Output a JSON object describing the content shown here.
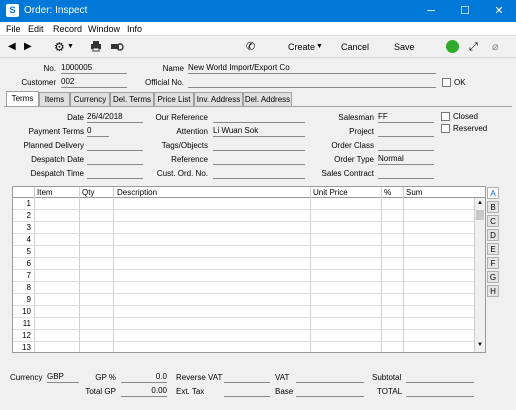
{
  "window": {
    "title": "Order: Inspect",
    "minimize": "─",
    "maximize": "☐",
    "close": "✕"
  },
  "menu": [
    "File",
    "Edit",
    "Record",
    "Window",
    "Info"
  ],
  "toolbar": {
    "create": "Create",
    "cancel": "Cancel",
    "save": "Save"
  },
  "head": {
    "no_label": "No.",
    "no_value": "1000005",
    "name_label": "Name",
    "name_value": "New World Import/Export Co",
    "customer_label": "Customer",
    "customer_value": "002",
    "official_label": "Official No.",
    "official_value": "",
    "ok_label": "OK"
  },
  "tabs": [
    "Terms",
    "Items",
    "Currency",
    "Del. Terms",
    "Price List",
    "Inv. Address",
    "Del. Address"
  ],
  "terms": {
    "date_label": "Date",
    "date_value": "26/4/2018",
    "payment_label": "Payment Terms",
    "payment_value": "0",
    "planned_label": "Planned Delivery",
    "planned_value": "",
    "despdate_label": "Despatch Date",
    "despdate_value": "",
    "desptime_label": "Despatch Time",
    "desptime_value": "",
    "ourref_label": "Our Reference",
    "ourref_value": "",
    "attention_label": "Attention",
    "attention_value": "Li Wuan Sok",
    "tags_label": "Tags/Objects",
    "tags_value": "",
    "reference_label": "Reference",
    "reference_value": "",
    "custord_label": "Cust. Ord. No.",
    "custord_value": "",
    "salesman_label": "Salesman",
    "salesman_value": "FF",
    "project_label": "Project",
    "project_value": "",
    "orderclass_label": "Order Class",
    "orderclass_value": "",
    "ordertype_label": "Order Type",
    "ordertype_value": "Normal",
    "salescontract_label": "Sales Contract",
    "salescontract_value": "",
    "closed_label": "Closed",
    "reserved_label": "Reserved"
  },
  "grid": {
    "headers": [
      "Item",
      "Qty",
      "Description",
      "Unit Price",
      "%",
      "Sum"
    ],
    "rows": [
      "1",
      "2",
      "3",
      "4",
      "5",
      "6",
      "7",
      "8",
      "9",
      "10",
      "11",
      "12",
      "13"
    ]
  },
  "side_tabs": [
    "A",
    "B",
    "C",
    "D",
    "E",
    "F",
    "G",
    "H"
  ],
  "footer": {
    "currency_label": "Currency",
    "currency_value": "GBP",
    "gp_label": "GP %",
    "gp_value": "0.0",
    "totalgp_label": "Total GP",
    "totalgp_value": "0.00",
    "revvat_label": "Reverse VAT",
    "revvat_value": "",
    "exttax_label": "Ext. Tax",
    "exttax_value": "",
    "vat_label": "VAT",
    "vat_value": "",
    "base_label": "Base",
    "base_value": "",
    "subtotal_label": "Subtotal",
    "subtotal_value": "",
    "total_label": "TOTAL",
    "total_value": ""
  }
}
